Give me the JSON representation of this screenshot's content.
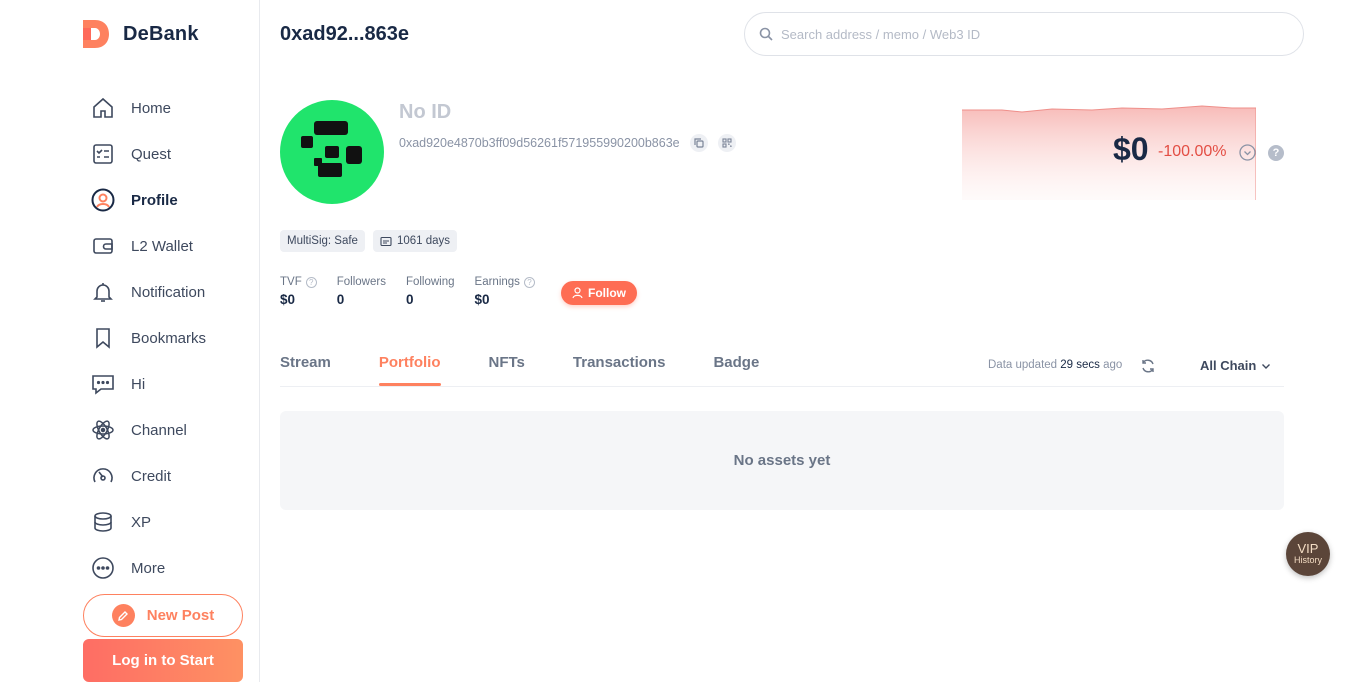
{
  "brand": {
    "name": "DeBank",
    "accent": "#fe815f"
  },
  "sidebar": {
    "items": [
      {
        "label": "Home",
        "icon": "home-icon"
      },
      {
        "label": "Quest",
        "icon": "quest-icon"
      },
      {
        "label": "Profile",
        "icon": "profile-icon",
        "active": true
      },
      {
        "label": "L2 Wallet",
        "icon": "wallet-icon"
      },
      {
        "label": "Notification",
        "icon": "bell-icon"
      },
      {
        "label": "Bookmarks",
        "icon": "bookmark-icon"
      },
      {
        "label": "Hi",
        "icon": "chat-icon"
      },
      {
        "label": "Channel",
        "icon": "atom-icon"
      },
      {
        "label": "Credit",
        "icon": "gauge-icon"
      },
      {
        "label": "XP",
        "icon": "coins-stack-icon"
      },
      {
        "label": "More",
        "icon": "more-icon"
      }
    ],
    "new_post_label": "New Post",
    "login_label": "Log in to Start"
  },
  "header": {
    "address_short": "0xad92...863e",
    "search_placeholder": "Search address / memo / Web3 ID"
  },
  "profile": {
    "name": "No ID",
    "address_full": "0xad920e4870b3ff09d56261f571955990200b863e",
    "balance": "$0",
    "change": "-100.00%",
    "tags": [
      "MultiSig: Safe",
      "1061 days"
    ],
    "stats": [
      {
        "label": "TVF",
        "value": "$0",
        "help": true
      },
      {
        "label": "Followers",
        "value": "0"
      },
      {
        "label": "Following",
        "value": "0"
      },
      {
        "label": "Earnings",
        "value": "$0",
        "help": true
      }
    ],
    "follow_label": "Follow"
  },
  "tabs": {
    "items": [
      "Stream",
      "Portfolio",
      "NFTs",
      "Transactions",
      "Badge"
    ],
    "active_index": 1,
    "updated_prefix": "Data updated",
    "updated_time": "29 secs",
    "updated_suffix": "ago",
    "chain_filter": "All Chain"
  },
  "portfolio": {
    "empty_text": "No assets yet"
  },
  "vip": {
    "title": "VIP",
    "subtitle": "History"
  }
}
